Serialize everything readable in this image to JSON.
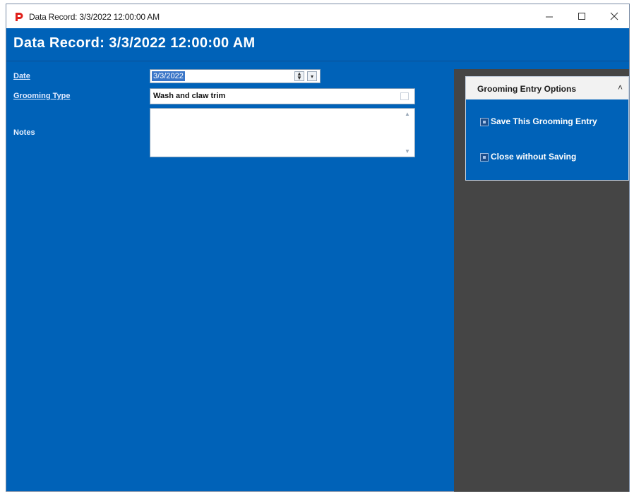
{
  "window": {
    "title": "Data Record: 3/3/2022 12:00:00 AM",
    "accent_color": "#0062b8",
    "side_panel_color": "#454545",
    "app_icon": "p-logo-icon"
  },
  "header": {
    "title": "Data Record: 3/3/2022 12:00:00 AM"
  },
  "form": {
    "date_label": "Date",
    "date_value": "3/3/2022",
    "grooming_type_label": "Grooming Type",
    "grooming_type_value": "Wash and claw trim",
    "notes_label": "Notes",
    "notes_value": ""
  },
  "options": {
    "title": "Grooming Entry Options",
    "collapse_icon": "double-chevron-up-icon",
    "save_label": "Save This Grooming Entry",
    "close_label": "Close without Saving"
  }
}
